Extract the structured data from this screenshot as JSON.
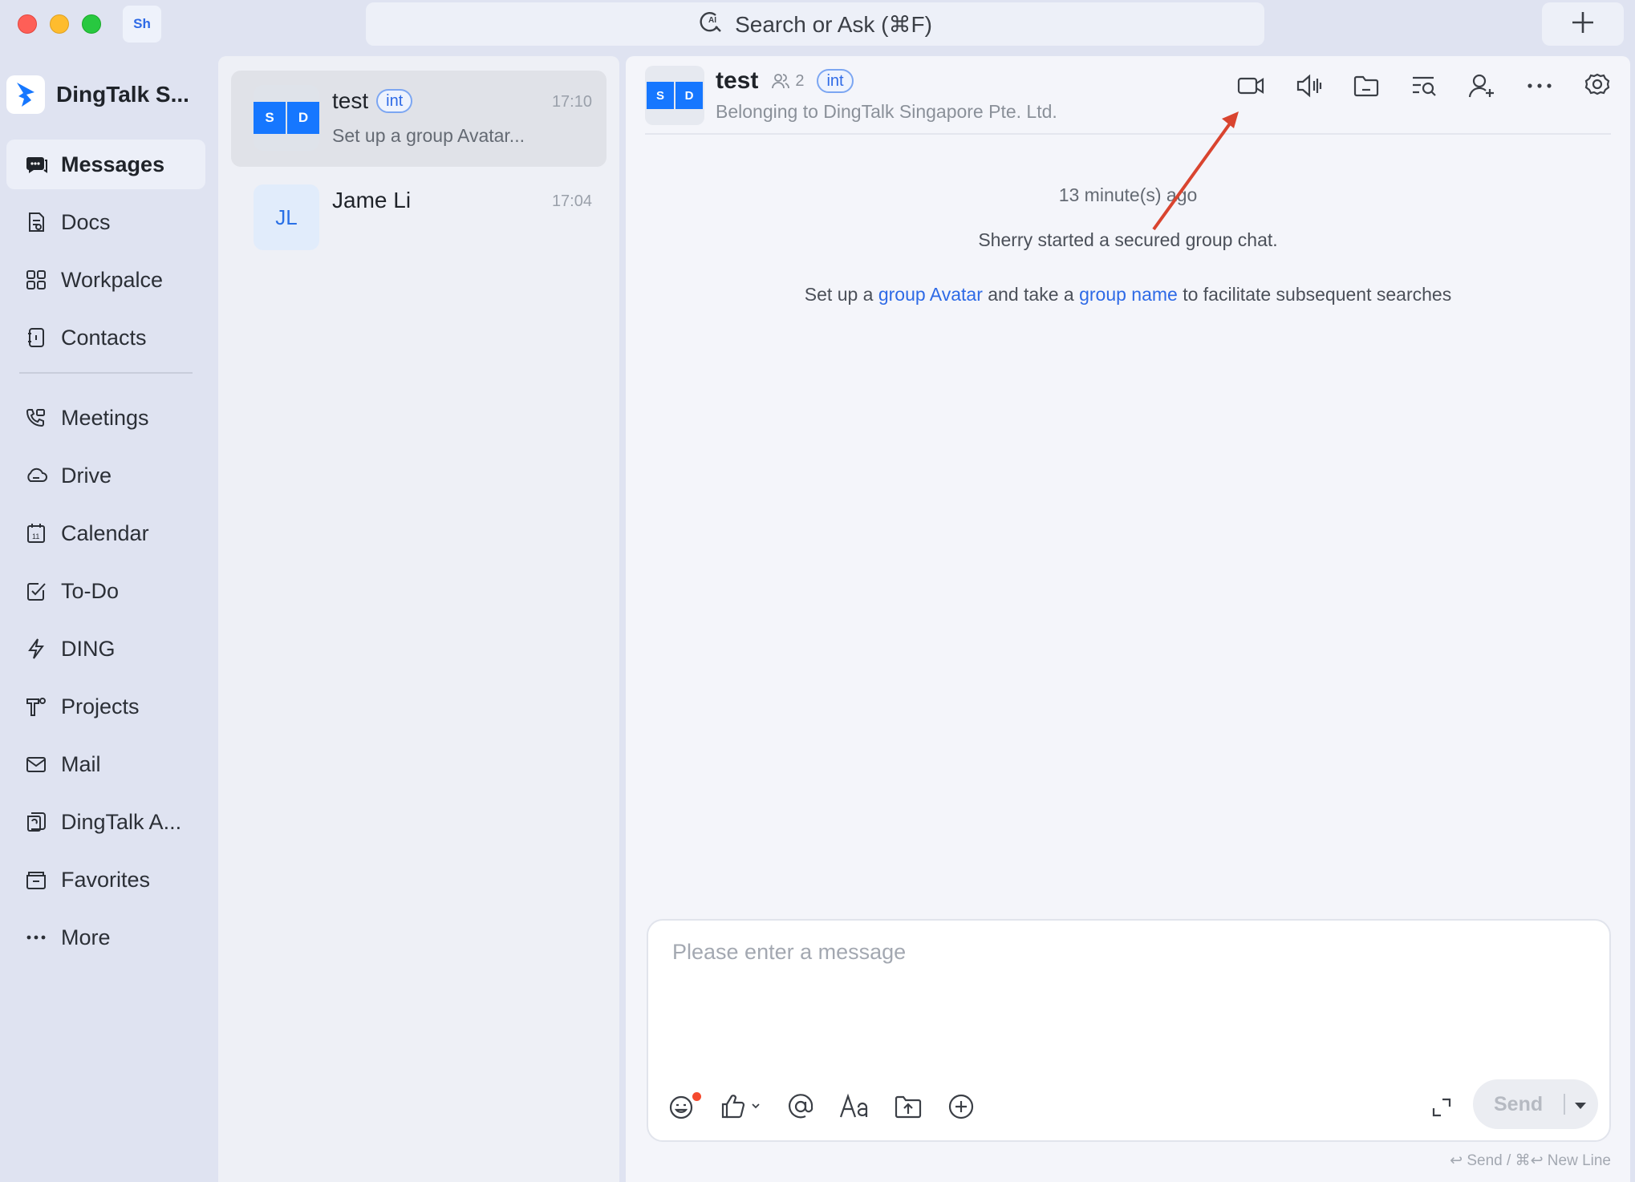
{
  "window": {
    "workspace_badge": "Sh",
    "search_placeholder": "Search or Ask  (⌘F)"
  },
  "sidebar": {
    "org_name": "DingTalk S...",
    "items": [
      {
        "label": "Messages",
        "icon": "messages-icon",
        "active": true
      },
      {
        "label": "Docs",
        "icon": "docs-icon"
      },
      {
        "label": "Workpalce",
        "icon": "workplace-icon"
      },
      {
        "label": "Contacts",
        "icon": "contacts-icon"
      }
    ],
    "items2": [
      {
        "label": "Meetings",
        "icon": "meetings-icon"
      },
      {
        "label": "Drive",
        "icon": "drive-icon"
      },
      {
        "label": "Calendar",
        "icon": "calendar-icon"
      },
      {
        "label": "To-Do",
        "icon": "todo-icon"
      },
      {
        "label": "DING",
        "icon": "ding-icon"
      },
      {
        "label": "Projects",
        "icon": "projects-icon"
      },
      {
        "label": "Mail",
        "icon": "mail-icon"
      },
      {
        "label": "DingTalk A...",
        "icon": "dingtalk-ai-icon"
      },
      {
        "label": "Favorites",
        "icon": "favorites-icon"
      },
      {
        "label": "More",
        "icon": "more-icon"
      }
    ]
  },
  "conversations": [
    {
      "name": "test",
      "tag": "int",
      "time": "17:10",
      "preview": "Set up a group Avatar...",
      "avatar": [
        "S",
        "D"
      ],
      "active": true
    },
    {
      "name": "Jame Li",
      "time": "17:04",
      "avatar_initials": "JL"
    }
  ],
  "chat": {
    "title": "test",
    "member_count": "2",
    "tag": "int",
    "subtitle": "Belonging to DingTalk Singapore Pte. Ltd.",
    "avatar": [
      "S",
      "D"
    ],
    "header_tools": [
      "video-call-icon",
      "voice-call-icon",
      "folder-icon",
      "search-history-icon",
      "add-member-icon",
      "more-options-icon",
      "settings-icon"
    ],
    "messages": {
      "time": "13 minute(s) ago",
      "started": "Sherry started a secured group chat.",
      "tip_prefix": "Set up a ",
      "tip_link1": "group Avatar",
      "tip_middle": " and take a ",
      "tip_link2": "group name",
      "tip_suffix": " to facilitate subsequent searches"
    },
    "composer": {
      "placeholder": "Please enter a message",
      "send_label": "Send",
      "hint": "↩ Send / ⌘↩ New Line"
    }
  },
  "colors": {
    "accent": "#1677ff",
    "link": "#2e6ae6",
    "annotation_arrow": "#d9442f"
  }
}
